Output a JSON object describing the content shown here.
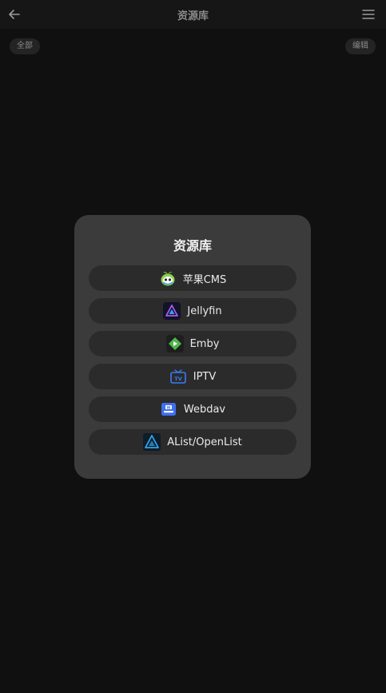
{
  "header": {
    "title": "资源库",
    "back_icon": "arrow-left-icon",
    "menu_icon": "hamburger-menu-icon"
  },
  "filters": {
    "all_label": "全部",
    "edit_label": "编辑"
  },
  "dialog": {
    "title": "资源库",
    "options": [
      {
        "label": "苹果CMS",
        "icon": "apple-cms-icon"
      },
      {
        "label": "Jellyfin",
        "icon": "jellyfin-icon"
      },
      {
        "label": "Emby",
        "icon": "emby-icon"
      },
      {
        "label": "IPTV",
        "icon": "iptv-icon"
      },
      {
        "label": "Webdav",
        "icon": "webdav-icon"
      },
      {
        "label": "AList/OpenList",
        "icon": "alist-icon"
      }
    ]
  },
  "colors": {
    "background": "#101010",
    "dialog": "#3b3b3b",
    "option": "#2b2b2b",
    "jellyfin_accent": "#a55cf0",
    "emby_accent": "#52b54b",
    "iptv_accent": "#3a7bf5",
    "webdav_accent": "#3f6ff0",
    "alist_accent": "#2fa4e7"
  }
}
